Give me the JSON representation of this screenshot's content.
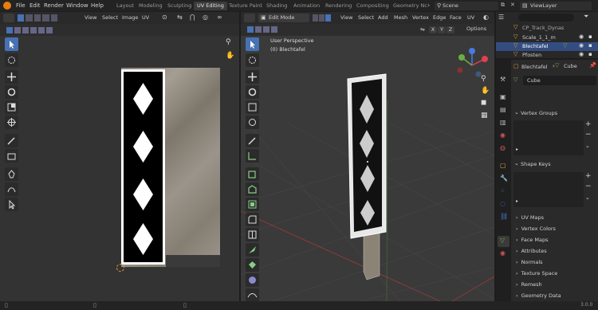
{
  "menubar": {
    "items": [
      "File",
      "Edit",
      "Render",
      "Window",
      "Help"
    ],
    "workspaces": [
      "Layout",
      "Modeling",
      "Sculpting",
      "UV Editing",
      "Texture Paint",
      "Shading",
      "Animation",
      "Rendering",
      "Compositing",
      "Geometry Nc"
    ],
    "scene": "Scene",
    "view_layer": "ViewLayer"
  },
  "uv_editor": {
    "menus": [
      "View",
      "Select",
      "Image",
      "UV"
    ]
  },
  "viewport": {
    "mode": "Edit Mode",
    "menus": [
      "View",
      "Select",
      "Add",
      "Mesh",
      "Vertex",
      "Edge",
      "Face",
      "UV"
    ],
    "axes": [
      "X",
      "Y",
      "Z"
    ],
    "options": "Options",
    "perspective": "User Perspective",
    "object_label": "(0) Blechtafel"
  },
  "outliner": {
    "items": [
      {
        "name": "CP_Track_Dynas"
      },
      {
        "name": "Scale_1_1_m"
      },
      {
        "name": "Blechtafel"
      },
      {
        "name": "Pfosten"
      }
    ]
  },
  "properties": {
    "object": "Blechtafel",
    "mesh": "Cube",
    "data_name": "Cube",
    "sections": {
      "vertex_groups": "Vertex Groups",
      "shape_keys": "Shape Keys"
    },
    "collapsed": [
      "UV Maps",
      "Vertex Colors",
      "Face Maps",
      "Attributes",
      "Normals",
      "Texture Space",
      "Remesh",
      "Geometry Data"
    ]
  },
  "statusbar": {
    "version": "3.0.0"
  },
  "colors": {
    "accent": "#4772b3",
    "selected_row": "#334d80"
  }
}
